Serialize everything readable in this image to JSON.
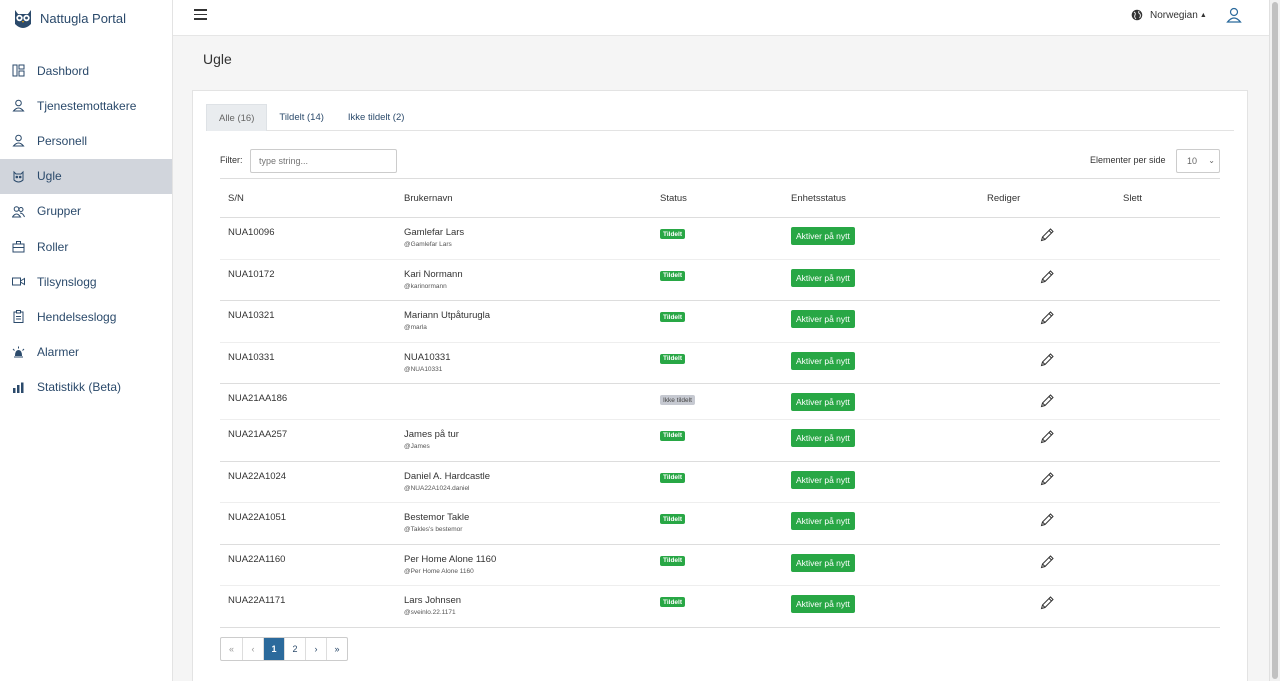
{
  "brand": {
    "name": "Nattugla Portal"
  },
  "sidebar": {
    "items": [
      {
        "label": "Dashbord",
        "icon": "dashboard-icon"
      },
      {
        "label": "Tjenestemottakere",
        "icon": "person-icon"
      },
      {
        "label": "Personell",
        "icon": "person-icon"
      },
      {
        "label": "Ugle",
        "icon": "owl-icon",
        "active": true
      },
      {
        "label": "Grupper",
        "icon": "group-icon"
      },
      {
        "label": "Roller",
        "icon": "briefcase-icon"
      },
      {
        "label": "Tilsynslogg",
        "icon": "video-icon"
      },
      {
        "label": "Hendelseslogg",
        "icon": "clipboard-icon"
      },
      {
        "label": "Alarmer",
        "icon": "alarm-icon"
      },
      {
        "label": "Statistikk (Beta)",
        "icon": "chart-icon"
      }
    ]
  },
  "topbar": {
    "language": "Norwegian"
  },
  "page": {
    "title": "Ugle"
  },
  "tabs": [
    {
      "label": "Alle (16)",
      "active": true
    },
    {
      "label": "Tildelt (14)"
    },
    {
      "label": "Ikke tildelt (2)"
    }
  ],
  "filter": {
    "label": "Filter:",
    "placeholder": "type string..."
  },
  "per_page": {
    "label": "Elementer per side",
    "value": "10"
  },
  "table": {
    "headers": {
      "sn": "S/N",
      "username": "Brukernavn",
      "status": "Status",
      "device_status": "Enhetsstatus",
      "edit": "Rediger",
      "delete": "Slett"
    },
    "action_label": "Aktiver på nytt",
    "rows": [
      {
        "sn": "NUA10096",
        "name": "Gamlefar Lars",
        "handle": "@Gamlefar Lars",
        "status": "Tildelt"
      },
      {
        "sn": "NUA10172",
        "name": "Kari Normann",
        "handle": "@karinormann",
        "status": "Tildelt"
      },
      {
        "sn": "NUA10321",
        "name": "Mariann Utpåturugla",
        "handle": "@marla",
        "status": "Tildelt"
      },
      {
        "sn": "NUA10331",
        "name": "NUA10331",
        "handle": "@NUA10331",
        "status": "Tildelt"
      },
      {
        "sn": "NUA21AA186",
        "name": "",
        "handle": "",
        "status": "Ikke tildelt"
      },
      {
        "sn": "NUA21AA257",
        "name": "James på tur",
        "handle": "@James",
        "status": "Tildelt"
      },
      {
        "sn": "NUA22A1024",
        "name": "Daniel A. Hardcastle",
        "handle": "@NUA22A1024.daniel",
        "status": "Tildelt"
      },
      {
        "sn": "NUA22A1051",
        "name": "Bestemor Takle",
        "handle": "@Takles's bestemor",
        "status": "Tildelt"
      },
      {
        "sn": "NUA22A1160",
        "name": "Per Home Alone 1160",
        "handle": "@Per Home Alone 1160",
        "status": "Tildelt"
      },
      {
        "sn": "NUA22A1171",
        "name": "Lars Johnsen",
        "handle": "@sveinlo.22.1171",
        "status": "Tildelt"
      }
    ]
  },
  "pagination": {
    "first": "«",
    "prev": "‹",
    "pages": [
      "1",
      "2"
    ],
    "next": "›",
    "last": "»",
    "current": "1"
  }
}
